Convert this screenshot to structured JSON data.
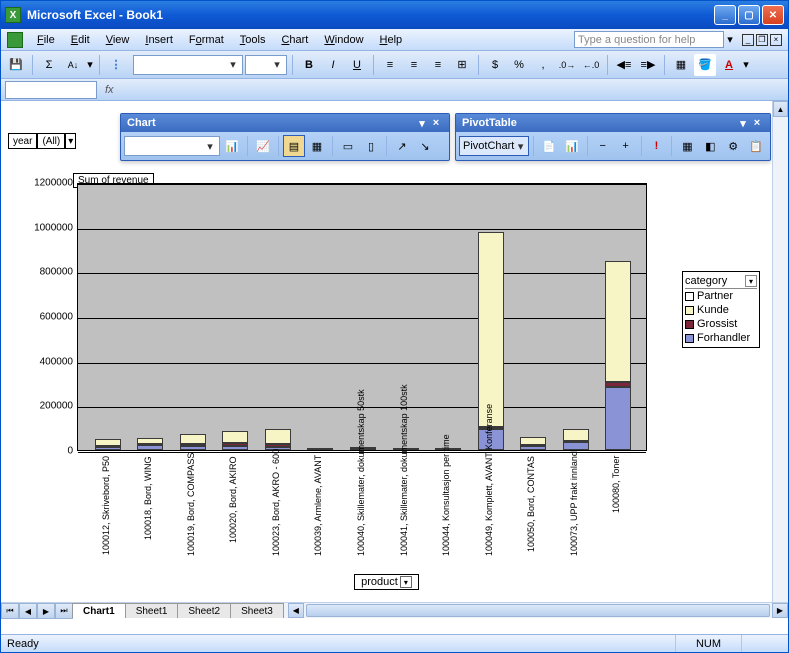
{
  "title": "Microsoft Excel - Book1",
  "menu": {
    "file": "File",
    "edit": "Edit",
    "view": "View",
    "insert": "Insert",
    "format": "Format",
    "tools": "Tools",
    "chart": "Chart",
    "window": "Window",
    "help": "Help"
  },
  "helpPlaceholder": "Type a question for help",
  "yearFilter": {
    "label": "year",
    "value": "(All)"
  },
  "floatChart": {
    "title": "Chart"
  },
  "floatPivot": {
    "title": "PivotTable",
    "btn": "PivotChart"
  },
  "chart": {
    "title": "Sum of revenue",
    "xaxis": "product",
    "legend_title": "category",
    "series": [
      "Partner",
      "Kunde",
      "Grossist",
      "Forhandler"
    ],
    "colors": {
      "Partner": "#ffffff",
      "Kunde": "#f7f5c5",
      "Grossist": "#7c263a",
      "Forhandler": "#8a93d6"
    },
    "ymax": 1200000,
    "yticks": [
      0,
      200000,
      400000,
      600000,
      800000,
      1000000,
      1200000
    ]
  },
  "chart_data": {
    "type": "bar",
    "stacked": true,
    "title": "Sum of revenue",
    "xlabel": "product",
    "ylabel": "",
    "ylim": [
      0,
      1200000
    ],
    "categories": [
      "100012, Skrivebord, P50",
      "100018, Bord, WING",
      "100019, Bord, COMPASS",
      "100020, Bord, AKIRO",
      "100023, Bord, AKRO - 600",
      "100039, Armlene, AVANT",
      "100040, Skillemater, dokumentskap 50stk",
      "100041, Skillemater, dokumentskap 100stk",
      "100044, Konsultasjon per time",
      "100049, Komplett, AVANT Konferanse",
      "100050, Bord, CONTAS",
      "100073, UPP frakt innland",
      "100080, Toner"
    ],
    "series": [
      {
        "name": "Forhandler",
        "values": [
          15000,
          22000,
          20000,
          18000,
          15000,
          0,
          2000,
          0,
          2000,
          95000,
          20000,
          35000,
          280000
        ]
      },
      {
        "name": "Grossist",
        "values": [
          3000,
          5000,
          8000,
          12000,
          10000,
          0,
          1000,
          0,
          0,
          10000,
          4000,
          5000,
          25000
        ]
      },
      {
        "name": "Kunde",
        "values": [
          30000,
          28000,
          45000,
          55000,
          70000,
          2000,
          5000,
          7000,
          6000,
          870000,
          35000,
          55000,
          540000
        ]
      },
      {
        "name": "Partner",
        "values": [
          0,
          0,
          0,
          0,
          0,
          0,
          0,
          0,
          0,
          0,
          0,
          0,
          0
        ]
      }
    ],
    "legend": [
      "Partner",
      "Kunde",
      "Grossist",
      "Forhandler"
    ]
  },
  "tabs": [
    "Chart1",
    "Sheet1",
    "Sheet2",
    "Sheet3"
  ],
  "activeTab": 0,
  "status": {
    "ready": "Ready",
    "num": "NUM"
  }
}
